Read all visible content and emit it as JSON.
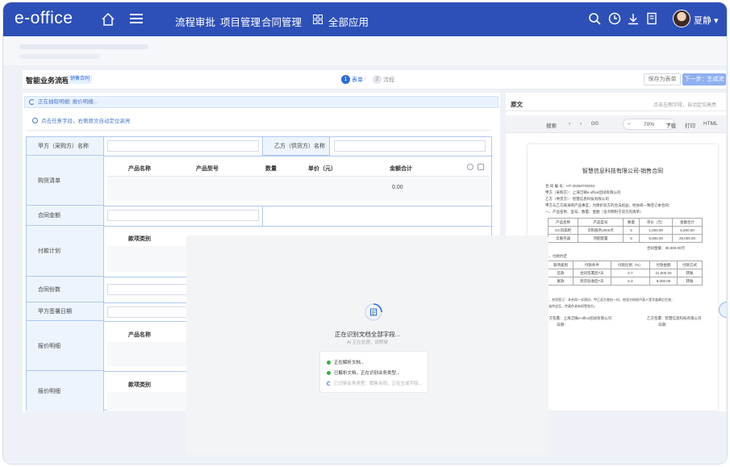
{
  "header": {
    "logo": "e-office",
    "nav": [
      "流程审批",
      "项目管理",
      "合同管理",
      "全部应用"
    ],
    "user": "夏静"
  },
  "process": {
    "title": "智能业务流程",
    "tag": "销售合同",
    "steps": [
      {
        "num": "1",
        "label": "表单"
      },
      {
        "num": "2",
        "label": "流程"
      }
    ],
    "save_label": "保存为表单",
    "next_label": "下一步：生成流"
  },
  "form": {
    "notice_extracting": "正在抽取明细: 报价明细...",
    "notice_hint": "点击任意字段，右侧原文自动定位高亮",
    "party_a_label": "甲方（采购方）名称",
    "party_b_label": "乙方（供货方）名称",
    "purchase_label": "购货清单",
    "purchase_headers": [
      "产品名称",
      "产品型号",
      "数量",
      "单价（元）",
      "金额合计"
    ],
    "purchase_total": "0.00",
    "amount_label": "合同金额",
    "payment_label": "付款计划",
    "payment_header": "款项类别",
    "contract_no_label": "合同份数",
    "sign_date_label": "甲方签署日期",
    "quote_label_1": "报价明细",
    "quote_header_1": "产品名称",
    "quote_label_2": "报价明细",
    "quote_header_2": "款项类别"
  },
  "preview": {
    "title": "原文",
    "hint": "点击左侧字段，自动定位高亮",
    "search": "搜索",
    "page": "0/0",
    "zoom": "70%",
    "download": "下载",
    "print": "打印",
    "html": "HTML",
    "doc_title": "智慧信息科技有限公司-销售合同",
    "lines": [
      "合 同 编 号：HT-20250703033",
      "甲方（采购方）：上海泛微e-office团试有限公司",
      "乙方（供货方）：智慧信息科技有限公司",
      "甲方与乙方就采购产品事宜，为保护双方的合法权益，经协商一致签订本合同：",
      "一、产品名称、型号、数量、金额（含点明附于双方的清单）"
    ],
    "table1_headers": [
      "产品名称",
      "产品型号",
      "数量",
      "单价（元）",
      "金额合计"
    ],
    "table1_rows": [
      [
        "OC风扇柜",
        "识别服务2000点",
        "5",
        "1,000.00",
        "5,000.00"
      ],
      [
        "云服务器",
        "顶配配置",
        "5",
        "5,000.00",
        "25,000.00"
      ]
    ],
    "total_line": "合同金额：30,000.00元",
    "section2": "二、付款约定",
    "table2_headers": [
      "款项类别",
      "付款条件",
      "付款比例（%）",
      "付款金额",
      "付款方式"
    ],
    "table2_rows": [
      [
        "首款",
        "合同签署后7天",
        "0.7",
        "21,000.00",
        "转账"
      ],
      [
        "尾款",
        "到货验收后7天",
        "0.3",
        "9,000.00",
        "转账"
      ]
    ],
    "section3": "三、合同签订：本合同一式两份，甲乙双方各执一份，经双方授权代表人签字盖章后生效，",
    "section3b": "该传送至，传真件具有同等效力。",
    "sign_a": "甲方签署：上海泛微e-office团试有限公司",
    "sign_b": "乙方签署：智慧信息科技有限公司",
    "date_a": "日期：",
    "date_b": "日期："
  },
  "overlay": {
    "title": "正在识别文档全部字段...",
    "subtitle": "AI 正在处理，请稍候",
    "steps": [
      {
        "label": "正在解析文档...",
        "done": true
      },
      {
        "label": "已解析文档，正在识别业务类型...",
        "done": true
      },
      {
        "label": "已识别业务类型：销售合同，正在生成字段...",
        "done": false
      }
    ]
  }
}
